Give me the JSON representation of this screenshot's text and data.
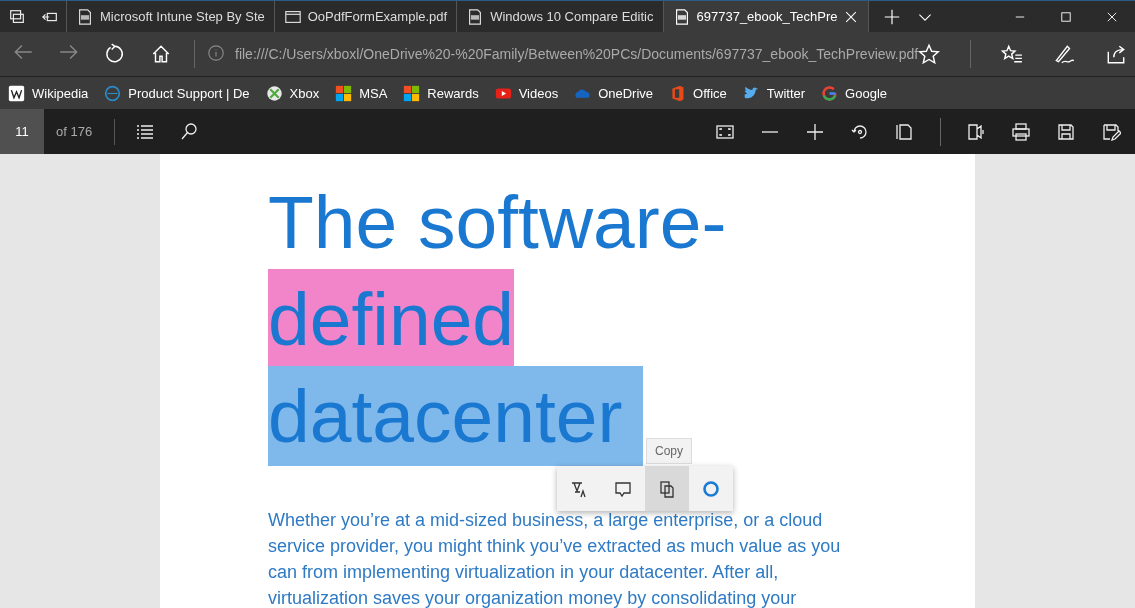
{
  "tabs": [
    {
      "title": "Microsoft Intune Step By Ste",
      "kind": "pdf",
      "selected": false
    },
    {
      "title": "OoPdfFormExample.pdf",
      "kind": "page",
      "selected": false
    },
    {
      "title": "Windows 10 Compare Editic",
      "kind": "pdf",
      "selected": false
    },
    {
      "title": "697737_ebook_TechPre",
      "kind": "pdf",
      "selected": true
    }
  ],
  "address": {
    "url": "file:///C:/Users/xboxl/OneDrive%20-%20Family/Between%20PCs/Documents/697737_ebook_TechPreview.pdf"
  },
  "favorites": [
    {
      "label": "Wikipedia",
      "kind": "wikipedia"
    },
    {
      "label": "Product Support | De",
      "kind": "globe"
    },
    {
      "label": "Xbox",
      "kind": "xbox"
    },
    {
      "label": "MSA",
      "kind": "windows"
    },
    {
      "label": "Rewards",
      "kind": "windows"
    },
    {
      "label": "Videos",
      "kind": "video"
    },
    {
      "label": "OneDrive",
      "kind": "cloud"
    },
    {
      "label": "Office",
      "kind": "office"
    },
    {
      "label": "Twitter",
      "kind": "bird"
    },
    {
      "label": "Google",
      "kind": "google"
    }
  ],
  "pdf_toolbar": {
    "page": "11",
    "page_count": "of 176"
  },
  "document": {
    "title_lines": [
      {
        "text": "The software-"
      },
      {
        "text": "defined",
        "color": "#f285c9"
      },
      {
        "text": "datacenter ",
        "color": "#7fb8ea"
      }
    ],
    "paragraph": "Whether you’re at a mid-sized business, a large enterprise, or a cloud service provider, you might think you’ve extracted as much value as you can from implementing virtualization in your datacenter. After all, virtualization saves your organization money by consolidating your"
  },
  "selection_menu": {
    "tooltip": "Copy",
    "actions": [
      {
        "kind": "highlight",
        "selected": false
      },
      {
        "kind": "comment",
        "selected": false
      },
      {
        "kind": "copy",
        "selected": true
      },
      {
        "kind": "cortana",
        "selected": false
      }
    ]
  }
}
